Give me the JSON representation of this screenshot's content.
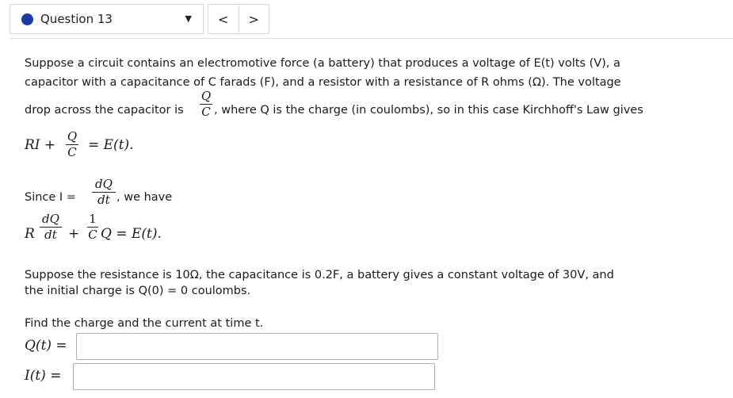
{
  "header": {
    "question_title": "Question 13",
    "dropdown_icon": "caret-down-icon",
    "prev_icon": "chevron-left-icon",
    "next_icon": "chevron-right-icon",
    "accent_color": "#1b3aa3"
  },
  "body": {
    "p1_line1": "Suppose a circuit contains an electromotive force (a battery) that produces a voltage of E(t) volts (V), a",
    "p1_line2": "capacitor with a capacitance of C farads (F), and a resistor with a resistance of R ohms (Ω). The voltage",
    "p1_line3a": "drop across the capacitor is",
    "frac_q": "Q",
    "frac_c": "C",
    "p1_line3b": ", where Q is the charge (in coulombs), so in this case Kirchhoff's Law gives",
    "eq1_left": "RI +",
    "eq1_right": "= E(t).",
    "since": "Since I =",
    "frac_dq": "dQ",
    "frac_dt": "dt",
    "we_have": ", we have",
    "eq2_r": "R",
    "eq2_plus": "+",
    "frac_one": "1",
    "eq2_right": "Q = E(t).",
    "p2_line1": "Suppose the resistance is 10Ω, the capacitance is 0.2F, a battery gives a constant voltage of 30V, and",
    "p2_line2": "the initial charge is Q(0) = 0 coulombs.",
    "find": "Find the charge and the current at time t."
  },
  "answers": {
    "q_label": "Q(t) =",
    "q_value": "",
    "i_label": "I(t) =",
    "i_value": ""
  }
}
